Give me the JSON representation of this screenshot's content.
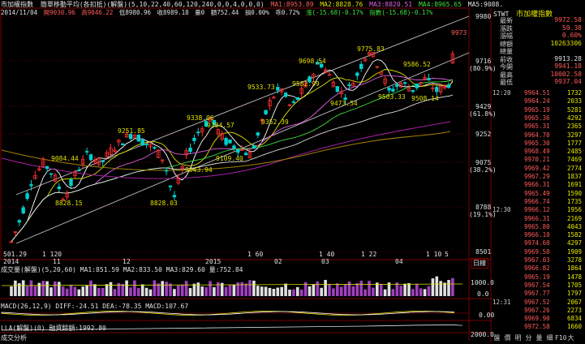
{
  "header": {
    "title": "市加權指數",
    "indicator": "簡單移動平均(各扣抵)(解盤)(5,10,22,40,60,120,240,0,0,4,0,0,0)",
    "ma1": "MA1:8953.89",
    "ma2": "MA2:8828.76",
    "ma3": "MA3:8820.51",
    "ma4": "MA4:8965.65",
    "ma5": "MA5:9088.",
    "date": "2014/11/04",
    "open": "開9030.96",
    "high": "高9046.22",
    "low": "低8980.96",
    "close": "收8989.18",
    "vol": "量0",
    "amt": "額752.44",
    "chg": "損0.00%",
    "deviation": "乖0.72%",
    "change": "漲(-15.68)-0.17%",
    "index": "指數(-15.68)-0.17%"
  },
  "price_chart": {
    "price_labels": [
      "9980",
      "9716",
      "9429",
      "9252",
      "9075",
      "8788",
      "8501"
    ],
    "price_sub": [
      "(80.9%)",
      "(61.8%)",
      "(38.2%)",
      "(19.1%)"
    ],
    "callouts": [
      "9698.54",
      "9775.83",
      "9586.52",
      "9533.73",
      "9582.99",
      "9473.54",
      "9503.33",
      "9508.14",
      "9251.85",
      "9338.06",
      "9284.57",
      "9352.39",
      "9084.44",
      "9109.40",
      "9043.94",
      "8828.15",
      "8828.03",
      "9973"
    ],
    "timeline": [
      "2014",
      "11",
      "12",
      "2015",
      "02",
      "03",
      "04"
    ],
    "timeline_marks": [
      "1 120",
      "1 60",
      "1 40",
      "1 22",
      "1 10",
      "5"
    ],
    "first_low": "501.29"
  },
  "volume_panel": {
    "title": "成交量(解盤)(5,20,60) MA1:851.59 MA2:833.50 MA3:829.60 量:752.84",
    "axis_top": "1000.0",
    "axis_bot": "0.0"
  },
  "macd_panel": {
    "title": "MACD(26,12,9) DIFF:-24.51 DEA:-78.35 MACD:107.67",
    "axis": "0.00"
  },
  "bottom_panel": {
    "label1": "LLA(解盤)(0) 融資餘額:1992.80",
    "label2": "成交分析",
    "axis": "2000.0",
    "date_btn": "日線"
  },
  "side": {
    "ticker": "STWT",
    "name": "市加權指數",
    "stats": [
      {
        "label": "最新",
        "value": "9972.58",
        "color": "#ff5a5a"
      },
      {
        "label": "漲跌",
        "value": "59.38",
        "color": "#ff5a5a"
      },
      {
        "label": "漲幅",
        "value": "0.60%",
        "color": "#ff5a5a"
      },
      {
        "label": "總額",
        "value": "10263306",
        "color": "#e0e000"
      },
      {
        "label": "總量",
        "value": "",
        "color": "#e0e000"
      },
      {
        "label": "前收",
        "value": "9913.28",
        "color": "#e0e0e0"
      },
      {
        "label": "今開",
        "value": "9941.18",
        "color": "#ff5a5a"
      },
      {
        "label": "最高",
        "value": "10002.58",
        "color": "#ff5a5a"
      },
      {
        "label": "最低",
        "value": "9937.04",
        "color": "#ff5a5a"
      }
    ],
    "ticks": [
      [
        "12:20",
        "9964.51",
        "1732"
      ],
      [
        "",
        "9964.24",
        "2033"
      ],
      [
        "",
        "9965.19",
        "5281"
      ],
      [
        "",
        "9965.36",
        "4292"
      ],
      [
        "",
        "9965.31",
        "2365"
      ],
      [
        "",
        "9964.70",
        "3297"
      ],
      [
        "",
        "9965.30",
        "1777"
      ],
      [
        "",
        "9968.49",
        "2485"
      ],
      [
        "",
        "9970.21",
        "7469"
      ],
      [
        "",
        "9969.42",
        "2774"
      ],
      [
        "",
        "9967.29",
        "1837"
      ],
      [
        "",
        "9966.31",
        "1691"
      ],
      [
        "",
        "9965.49",
        "1590"
      ],
      [
        "",
        "9966.74",
        "1735"
      ],
      [
        "12:30",
        "9966.12",
        "1956"
      ],
      [
        "",
        "9966.31",
        "2169"
      ],
      [
        "",
        "9965.80",
        "4043"
      ],
      [
        "",
        "9966.10",
        "1582"
      ],
      [
        "",
        "9974.60",
        "4297"
      ],
      [
        "",
        "9969.50",
        "1909"
      ],
      [
        "",
        "9967.03",
        "3278"
      ],
      [
        "",
        "9966.82",
        "1864"
      ],
      [
        "",
        "9965.19",
        "1478"
      ],
      [
        "",
        "9967.54",
        "1705"
      ],
      [
        "",
        "9967.77",
        "1797"
      ],
      [
        "12:31",
        "9967.52",
        "2067"
      ],
      [
        "",
        "9967.26",
        "2273"
      ],
      [
        "",
        "9969.90",
        "6834"
      ],
      [
        "",
        "9972.58",
        "1660"
      ]
    ],
    "tabs": [
      "盤",
      "價",
      "明",
      "分",
      "量",
      "細",
      "F10",
      "大"
    ]
  }
}
